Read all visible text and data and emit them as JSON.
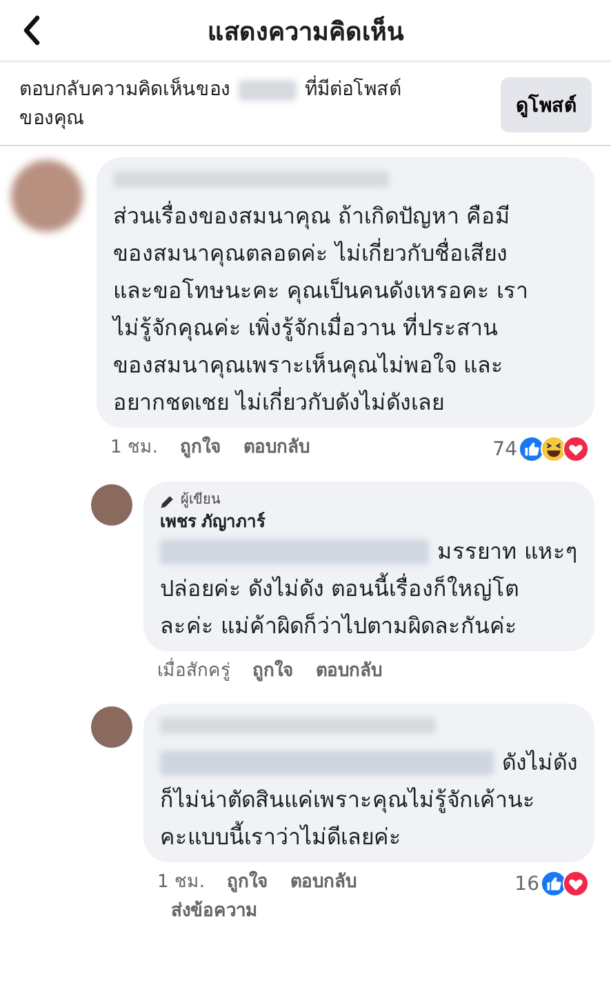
{
  "header": {
    "title": "แสดงความคิดเห็น"
  },
  "banner": {
    "text_before": "ตอบกลับความคิดเห็นของ",
    "text_after": "ที่มีต่อโพสต์",
    "text_line2": "ของคุณ",
    "button": "ดูโพสต์"
  },
  "comments": [
    {
      "indent": false,
      "lines": [
        {
          "redacted": false,
          "text": "ส่วนเรื่องของสมนาคุณ ถ้าเกิดปัญหา คือมี"
        },
        {
          "redacted": false,
          "text": "ของสมนาคุณตลอดค่ะ ไม่เกี่ยวกับชื่อเสียง"
        },
        {
          "redacted": false,
          "text": "และขอโทษนะคะ คุณเป็นคนดังเหรอคะ เรา"
        },
        {
          "redacted": false,
          "text": "ไม่รู้จักคุณค่ะ เพิ่งรู้จักเมื่อวาน  ที่ประสาน"
        },
        {
          "redacted": false,
          "text": "ของสมนาคุณเพราะเห็นคุณไม่พอใจ และ"
        },
        {
          "redacted": false,
          "text": "อยากชดเชย ไม่เกี่ยวกับดังไม่ดังเลย"
        }
      ],
      "actions": [
        "1 ชม.",
        "ถูกใจ",
        "ตอบกลับ"
      ],
      "count": "74",
      "reactions": [
        {
          "kind": "like"
        },
        {
          "kind": "haha"
        },
        {
          "kind": "love"
        }
      ]
    },
    {
      "indent": true,
      "author_badge": "ผู้เขียน",
      "author": "เพชร ภัญาภาร์",
      "lines": [
        {
          "redacted": true,
          "text": "มรรยาท แหะๆ"
        },
        {
          "redacted": false,
          "text": "ปล่อยค่ะ ดังไม่ดัง ตอนนี้เรื่องก็ใหญ่โต"
        },
        {
          "redacted": false,
          "text": "ละค่ะ แม่ค้าผิดก็ว่าไปตามผิดละกันค่ะ"
        }
      ],
      "actions": [
        "เมื่อสักครู่",
        "ถูกใจ",
        "ตอบกลับ"
      ]
    },
    {
      "indent": true,
      "lines": [
        {
          "redacted": true,
          "text": "ดังไม่ดัง"
        },
        {
          "redacted": false,
          "text": "ก็ไม่น่าตัดสินแค่เพราะคุณไม่รู้จักเค้านะ"
        },
        {
          "redacted": false,
          "text": "คะแบบนี้เราว่าไม่ดีเลยค่ะ"
        }
      ],
      "actions": [
        "1 ชม.",
        "ถูกใจ",
        "ตอบกลับ"
      ],
      "extra_action": "ส่งข้อความ",
      "count": "16",
      "reactions": [
        {
          "kind": "like"
        },
        {
          "kind": "love"
        }
      ]
    }
  ]
}
